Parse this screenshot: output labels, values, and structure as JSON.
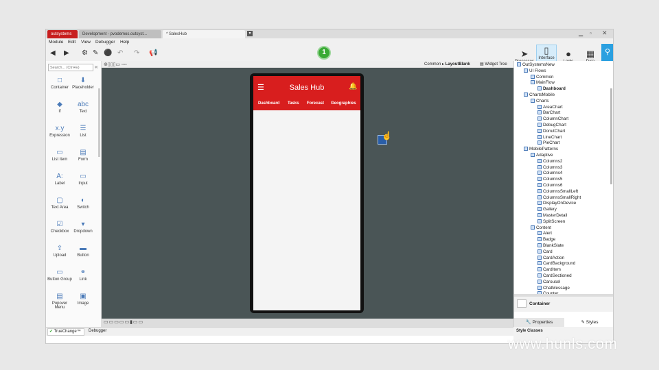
{
  "tabs": [
    {
      "label": "outsystems"
    },
    {
      "label": "Development - pvodemos.outsyst..."
    },
    {
      "label": "* SalesHub"
    }
  ],
  "menu": [
    "Module",
    "Edit",
    "View",
    "Debugger",
    "Help"
  ],
  "toolbar": {
    "step_badge": "1"
  },
  "mode_buttons": [
    {
      "label": "Processes",
      "icon": "processes-icon"
    },
    {
      "label": "Interface",
      "icon": "phone-icon"
    },
    {
      "label": "Logic",
      "icon": "logic-icon"
    },
    {
      "label": "Data",
      "icon": "data-icon"
    }
  ],
  "search": {
    "placeholder": "Search... (Ctrl+E)"
  },
  "widgets": [
    {
      "label": "Container",
      "icon": "□"
    },
    {
      "label": "Placeholder",
      "icon": "⬇"
    },
    {
      "label": "If",
      "icon": "◆"
    },
    {
      "label": "Text",
      "icon": "abc"
    },
    {
      "label": "Expression",
      "icon": "x.y"
    },
    {
      "label": "List",
      "icon": "☰"
    },
    {
      "label": "List Item",
      "icon": "▭"
    },
    {
      "label": "Form",
      "icon": "▤"
    },
    {
      "label": "Label",
      "icon": "A:"
    },
    {
      "label": "Input",
      "icon": "▭"
    },
    {
      "label": "Text Area",
      "icon": "▢"
    },
    {
      "label": "Switch",
      "icon": "◐"
    },
    {
      "label": "Checkbox",
      "icon": "☑"
    },
    {
      "label": "Dropdown",
      "icon": "▾"
    },
    {
      "label": "Upload",
      "icon": "⇪"
    },
    {
      "label": "Button",
      "icon": "▬"
    },
    {
      "label": "Button Group",
      "icon": "▭"
    },
    {
      "label": "Link",
      "icon": "⚭"
    },
    {
      "label": "Popover Menu",
      "icon": "▤"
    },
    {
      "label": "Image",
      "icon": "▣"
    }
  ],
  "canvas_header": {
    "breadcrumb_parent": "Common",
    "breadcrumb_current": "LayoutBlank",
    "widget_tree": "Widget Tree"
  },
  "app": {
    "title": "Sales Hub",
    "nav": [
      "Dashboard",
      "Tasks",
      "Forecast",
      "Geographies"
    ]
  },
  "tree": [
    {
      "label": "OutSystemsNew",
      "depth": 0
    },
    {
      "label": "UI Flows",
      "depth": 1
    },
    {
      "label": "Common",
      "depth": 2
    },
    {
      "label": "MainFlow",
      "depth": 2
    },
    {
      "label": "Dashboard",
      "depth": 3,
      "bold": true
    },
    {
      "label": "ChartsMobile",
      "depth": 1
    },
    {
      "label": "Charts",
      "depth": 2
    },
    {
      "label": "AreaChart",
      "depth": 3
    },
    {
      "label": "BarChart",
      "depth": 3
    },
    {
      "label": "ColumnChart",
      "depth": 3
    },
    {
      "label": "DebugChart",
      "depth": 3
    },
    {
      "label": "DonutChart",
      "depth": 3
    },
    {
      "label": "LineChart",
      "depth": 3
    },
    {
      "label": "PieChart",
      "depth": 3
    },
    {
      "label": "MobilePatterns",
      "depth": 1
    },
    {
      "label": "Adaptive",
      "depth": 2
    },
    {
      "label": "Columns2",
      "depth": 3
    },
    {
      "label": "Columns3",
      "depth": 3
    },
    {
      "label": "Columns4",
      "depth": 3
    },
    {
      "label": "Columns5",
      "depth": 3
    },
    {
      "label": "Columns6",
      "depth": 3
    },
    {
      "label": "ColumnsSmallLeft",
      "depth": 3
    },
    {
      "label": "ColumnsSmallRight",
      "depth": 3
    },
    {
      "label": "DisplayOnDevice",
      "depth": 3
    },
    {
      "label": "Gallery",
      "depth": 3
    },
    {
      "label": "MasterDetail",
      "depth": 3
    },
    {
      "label": "SplitScreen",
      "depth": 3
    },
    {
      "label": "Content",
      "depth": 2
    },
    {
      "label": "Alert",
      "depth": 3
    },
    {
      "label": "Badge",
      "depth": 3
    },
    {
      "label": "BlankSlate",
      "depth": 3
    },
    {
      "label": "Card",
      "depth": 3
    },
    {
      "label": "CardAction",
      "depth": 3
    },
    {
      "label": "CardBackground",
      "depth": 3
    },
    {
      "label": "CardItem",
      "depth": 3
    },
    {
      "label": "CardSectioned",
      "depth": 3
    },
    {
      "label": "Carousel",
      "depth": 3
    },
    {
      "label": "ChatMessage",
      "depth": 3
    },
    {
      "label": "Counter",
      "depth": 3
    }
  ],
  "properties": {
    "selected": "Container",
    "tab_properties": "Properties",
    "tab_styles": "Styles",
    "style_classes": "Style Classes"
  },
  "bottom": {
    "truechange": "TrueChange™",
    "debugger": "Debugger"
  },
  "watermark": "www.hunls.com",
  "colors": {
    "accent": "#d81e1e",
    "canvas": "#4a5556",
    "badge": "#3aaa35",
    "highlight": "#2ba0e0"
  }
}
